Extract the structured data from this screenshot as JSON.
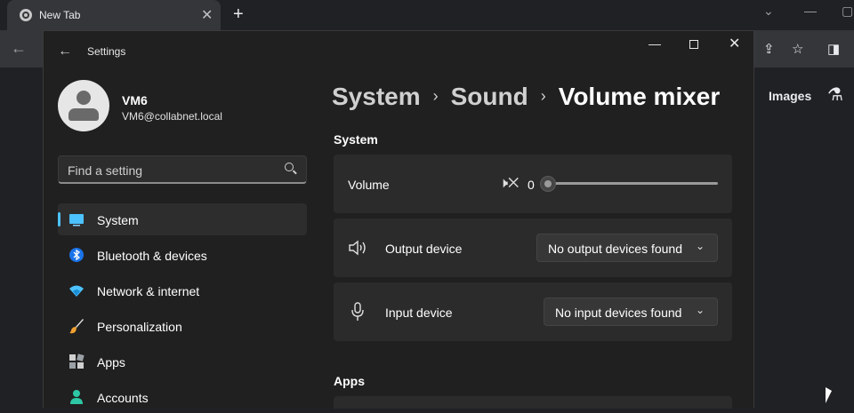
{
  "browser": {
    "tab_title": "New Tab",
    "tab_close": "✕",
    "new_tab": "+",
    "images_link": "Images"
  },
  "settings": {
    "window_title": "Settings",
    "user": {
      "name": "VM6",
      "email": "VM6@collabnet.local"
    },
    "search": {
      "placeholder": "Find a setting"
    },
    "nav": [
      {
        "label": "System",
        "icon": "system-icon",
        "active": true
      },
      {
        "label": "Bluetooth & devices",
        "icon": "bluetooth-icon"
      },
      {
        "label": "Network & internet",
        "icon": "wifi-icon"
      },
      {
        "label": "Personalization",
        "icon": "brush-icon"
      },
      {
        "label": "Apps",
        "icon": "apps-icon"
      },
      {
        "label": "Accounts",
        "icon": "accounts-icon"
      }
    ],
    "breadcrumb": {
      "first": "System",
      "second": "Sound",
      "current": "Volume mixer",
      "sep": "›"
    },
    "system_section": "System",
    "volume": {
      "label": "Volume",
      "value": "0",
      "level": 0
    },
    "output": {
      "label": "Output device",
      "value": "No output devices found"
    },
    "input": {
      "label": "Input device",
      "value": "No input devices found"
    },
    "apps_section": "Apps"
  },
  "colors": {
    "accent": "#4cc2ff",
    "window_bg": "#202020",
    "card_bg": "#2b2b2b"
  }
}
